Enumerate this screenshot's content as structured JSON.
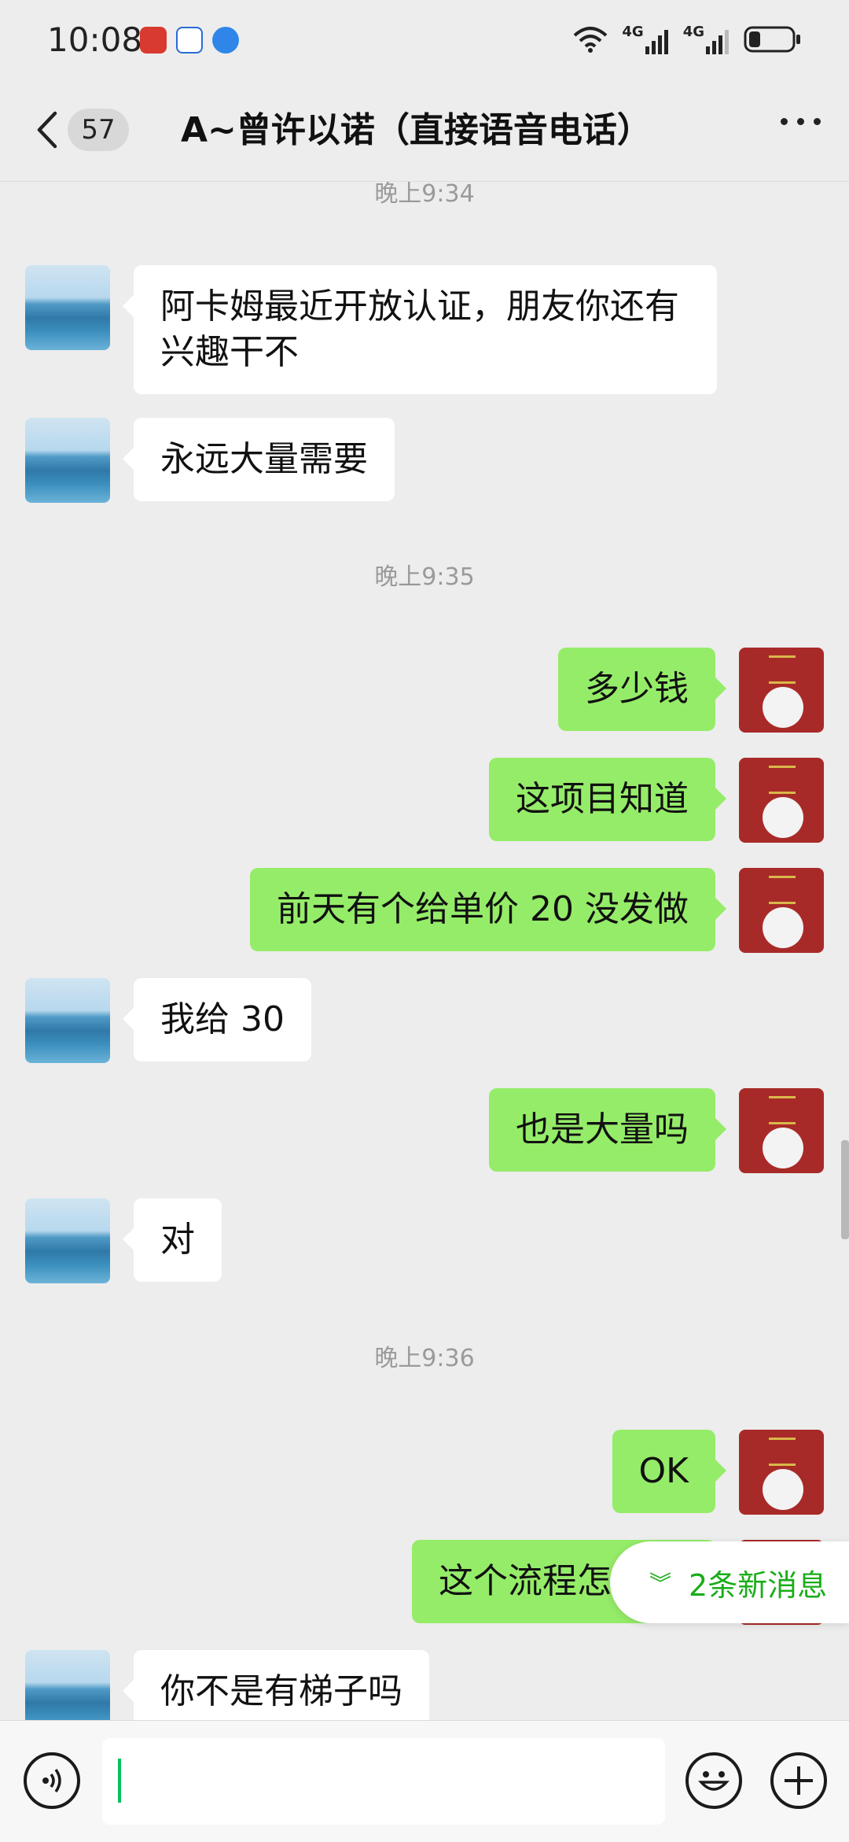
{
  "status_bar": {
    "time": "10:08",
    "network_1": "4G",
    "network_2": "4G"
  },
  "header": {
    "unread_count": "57",
    "title": "A~曾许以诺（直接语音电话）"
  },
  "messages": [
    {
      "kind": "time",
      "text": "晚上9:34"
    },
    {
      "kind": "in",
      "text": "阿卡姆最近开放认证，朋友你还有兴趣干不"
    },
    {
      "kind": "in",
      "text": "永远大量需要"
    },
    {
      "kind": "time",
      "text": "晚上9:35"
    },
    {
      "kind": "out",
      "text": "多少钱"
    },
    {
      "kind": "out",
      "text": "这项目知道"
    },
    {
      "kind": "out",
      "text": "前天有个给单价 20 没发做"
    },
    {
      "kind": "in",
      "text": "我给 30"
    },
    {
      "kind": "out",
      "text": "也是大量吗"
    },
    {
      "kind": "in",
      "text": "对"
    },
    {
      "kind": "time",
      "text": "晚上9:36"
    },
    {
      "kind": "out",
      "text": "OK"
    },
    {
      "kind": "out",
      "text": "这个流程怎"
    },
    {
      "kind": "in",
      "text": "你不是有梯子吗"
    }
  ],
  "new_messages_notice": "2条新消息",
  "input": {
    "value": ""
  },
  "colors": {
    "outgoing_bubble": "#95ec69",
    "incoming_bubble": "#ffffff",
    "accent_green": "#1aad19",
    "background": "#ededed"
  },
  "icons": {
    "back": "chevron-left-icon",
    "more": "more-dots-icon",
    "voice": "voice-icon",
    "emoji": "emoji-icon",
    "plus": "plus-icon",
    "new_msg": "double-chevron-down-icon"
  }
}
